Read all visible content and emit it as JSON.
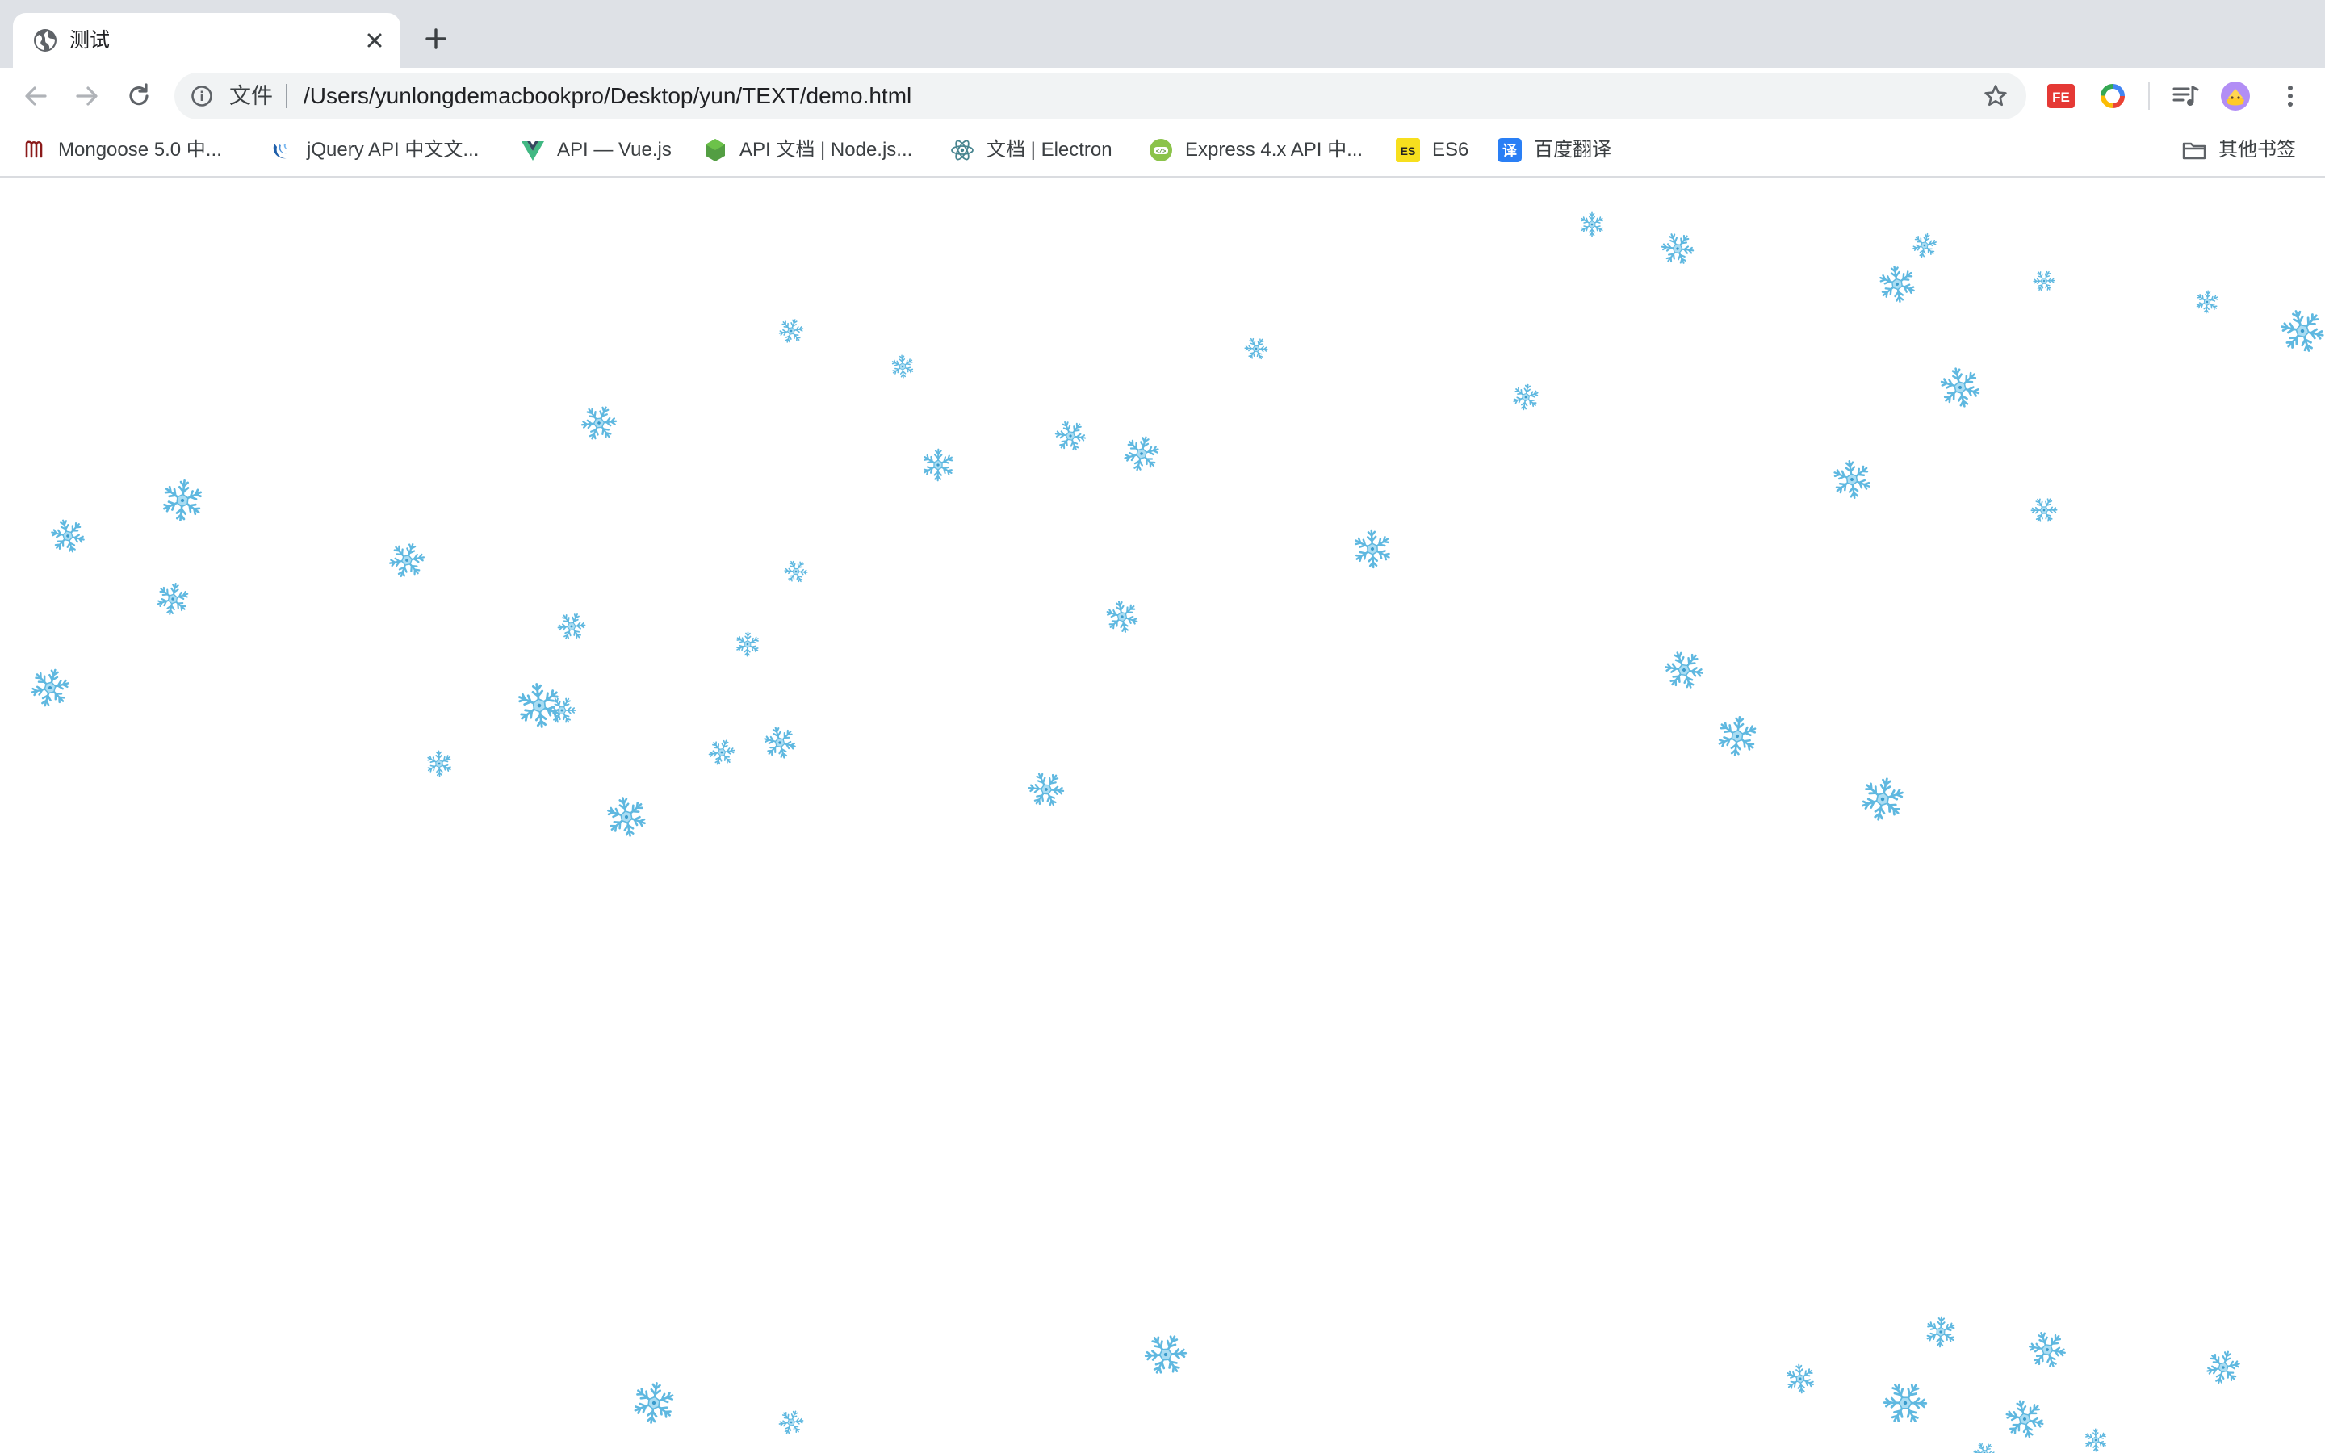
{
  "tab": {
    "title": "测试"
  },
  "omnibox": {
    "scheme_label": "文件",
    "url": "/Users/yunlongdemacbookpro/Desktop/yun/TEXT/demo.html"
  },
  "bookmarks": [
    {
      "label": "Mongoose 5.0 中...",
      "icon": "mongoose-icon"
    },
    {
      "label": "jQuery API 中文文...",
      "icon": "jquery-icon"
    },
    {
      "label": "API — Vue.js",
      "icon": "vue-icon"
    },
    {
      "label": "API 文档 | Node.js...",
      "icon": "nodejs-icon"
    },
    {
      "label": "文档 | Electron",
      "icon": "electron-icon"
    },
    {
      "label": "Express 4.x API 中...",
      "icon": "express-icon"
    },
    {
      "label": "ES6",
      "icon": "es6-icon"
    },
    {
      "label": "百度翻译",
      "icon": "baidu-translate-icon"
    }
  ],
  "other_bookmarks": {
    "label": "其他书签"
  },
  "extensions": {
    "fe_badge": "FE",
    "es_badge": "ES",
    "translate_badge": "译"
  },
  "colors": {
    "snowflake": "#5fb8e0",
    "tabstrip": "#dee1e6",
    "omnibox": "#f1f3f4",
    "avatar": "#b28ef5"
  }
}
